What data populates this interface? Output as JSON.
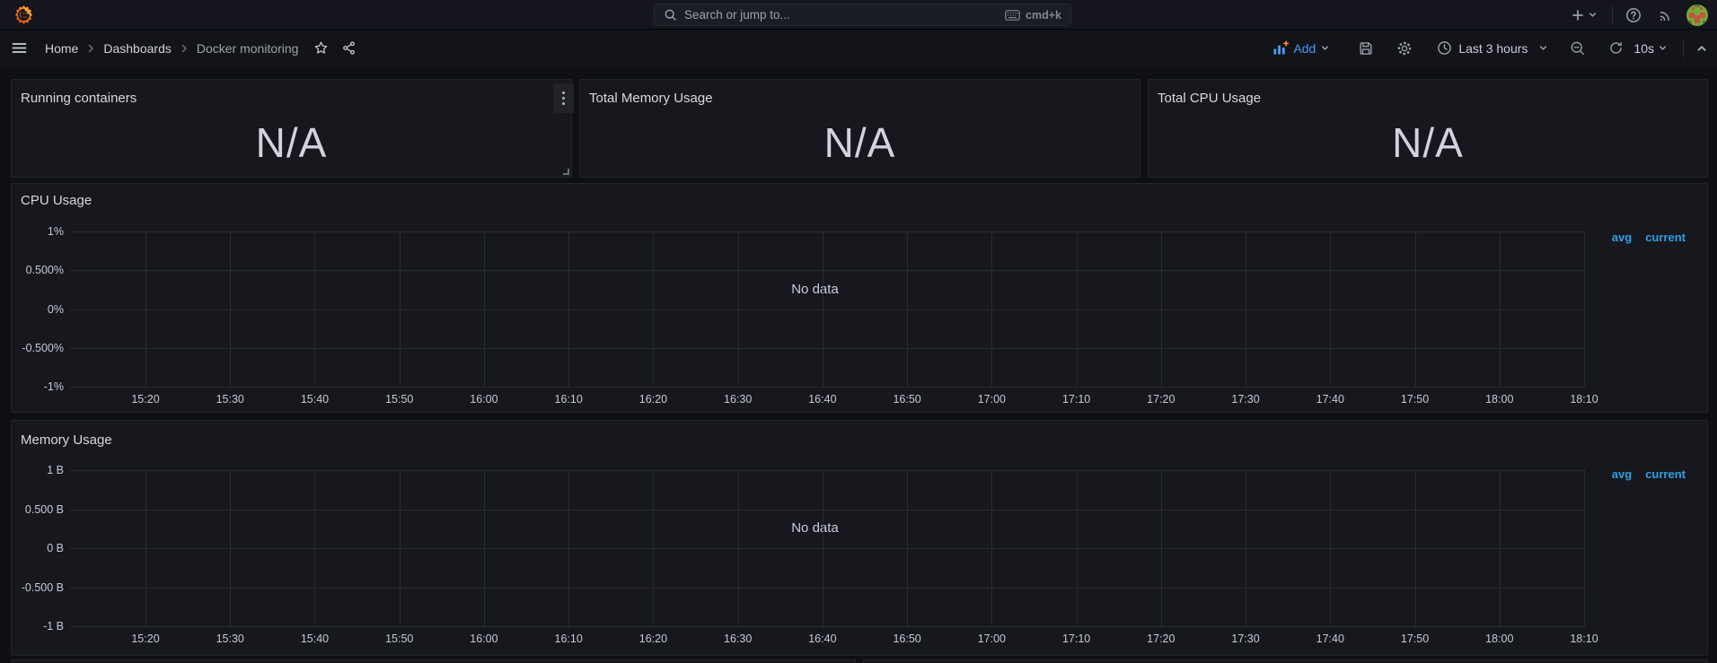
{
  "topbar": {
    "search": {
      "placeholder": "Search or jump to...",
      "shortcut": "cmd+k"
    }
  },
  "breadcrumb": {
    "items": [
      "Home",
      "Dashboards",
      "Docker monitoring"
    ]
  },
  "toolbar": {
    "add_label": "Add",
    "time_range": "Last 3 hours",
    "refresh_interval": "10s"
  },
  "stat_panels": [
    {
      "title": "Running containers",
      "value": "N/A"
    },
    {
      "title": "Total Memory Usage",
      "value": "N/A"
    },
    {
      "title": "Total CPU Usage",
      "value": "N/A"
    }
  ],
  "chart_data": [
    {
      "type": "line",
      "title": "CPU Usage",
      "series": [],
      "no_data": "No data",
      "legend": [
        "avg",
        "current"
      ],
      "legend_position": "top-right",
      "grid": true,
      "y_ticks": [
        "1%",
        "0.500%",
        "0%",
        "-0.500%",
        "-1%"
      ],
      "ylim": [
        "-1%",
        "1%"
      ],
      "x_ticks": [
        "15:20",
        "15:30",
        "15:40",
        "15:50",
        "16:00",
        "16:10",
        "16:20",
        "16:30",
        "16:40",
        "16:50",
        "17:00",
        "17:10",
        "17:20",
        "17:30",
        "17:40",
        "17:50",
        "18:00",
        "18:10"
      ],
      "xlim": [
        "15:20",
        "18:10"
      ]
    },
    {
      "type": "line",
      "title": "Memory Usage",
      "series": [],
      "no_data": "No data",
      "legend": [
        "avg",
        "current"
      ],
      "legend_position": "top-right",
      "grid": true,
      "y_ticks": [
        "1 B",
        "0.500 B",
        "0 B",
        "-0.500 B",
        "-1 B"
      ],
      "ylim": [
        "-1 B",
        "1 B"
      ],
      "x_ticks": [
        "15:20",
        "15:30",
        "15:40",
        "15:50",
        "16:00",
        "16:10",
        "16:20",
        "16:30",
        "16:40",
        "16:50",
        "17:00",
        "17:10",
        "17:20",
        "17:30",
        "17:40",
        "17:50",
        "18:00",
        "18:10"
      ],
      "xlim": [
        "15:20",
        "18:10"
      ]
    }
  ],
  "icons": {
    "grafana-logo": "orange-yellow flame spiral",
    "search-icon": "magnifier",
    "keyboard-icon": "keyboard outline",
    "plus-icon": "+",
    "chevron-down-icon": "v",
    "chevron-up-icon": "^",
    "help-icon": "? in circle",
    "news-icon": "rss arcs",
    "menu-icon": "hamburger",
    "breadcrumb-chevron": ">",
    "star-icon": "star outline",
    "share-icon": "share-alt nodes",
    "add-panel-icon": "bar chart with plus",
    "save-icon": "floppy disk",
    "settings-icon": "gear",
    "clock-icon": "clock",
    "zoom-out-icon": "magnifier with minus",
    "refresh-icon": "circular arrow",
    "kebab-icon": "vertical three dots",
    "resize-handle": "corner L"
  },
  "colors": {
    "accent_blue": "#4c9bf5",
    "legend_blue": "#2f9fe6",
    "accent_orange": "#fb8c2e",
    "panel_background": "#16181d",
    "page_background": "#0e1014"
  }
}
